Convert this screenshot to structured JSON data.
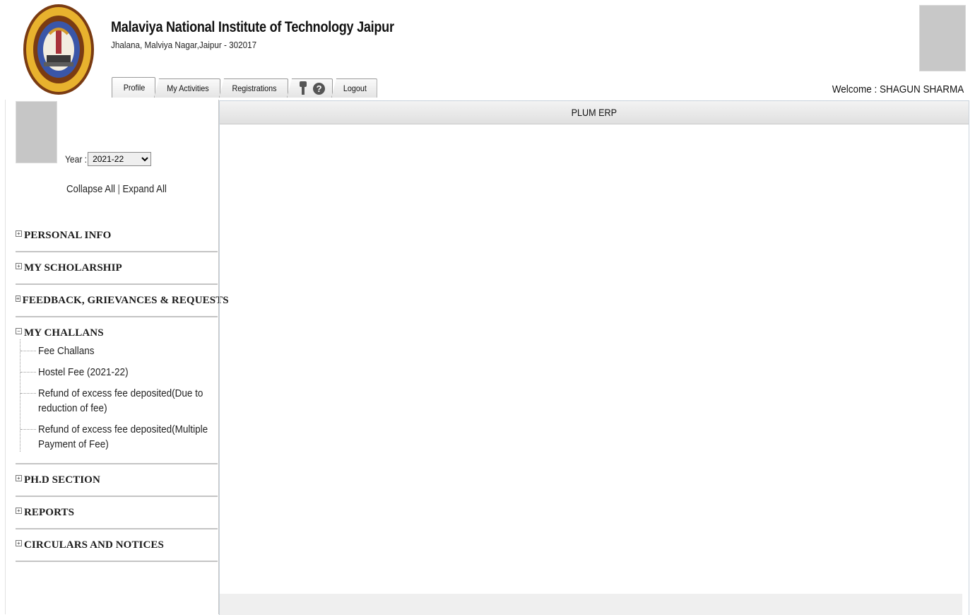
{
  "header": {
    "institute_name": "Malaviya National Institute of Technology Jaipur",
    "institute_address": "Jhalana, Malviya Nagar,Jaipur - 302017",
    "welcome_label": "Welcome : SHAGUN SHARMA"
  },
  "tabs": {
    "profile": "Profile",
    "my_activities": "My Activities",
    "registrations": "Registrations",
    "logout": "Logout",
    "help_glyph": "?"
  },
  "sidebar": {
    "year_label": "Year :",
    "year_selected": "2021-22",
    "collapse_all": "Collapse All",
    "separator": "|",
    "expand_all": "Expand All",
    "sections": [
      {
        "label": "PERSONAL INFO",
        "toggle": "+"
      },
      {
        "label": "MY SCHOLARSHIP",
        "toggle": "+"
      },
      {
        "label": "FEEDBACK, GRIEVANCES & REQUESTS",
        "toggle": "+"
      },
      {
        "label": "MY CHALLANS",
        "toggle": "−",
        "items": [
          "Fee Challans",
          "Hostel Fee (2021-22)",
          "Refund of excess fee deposited(Due to reduction of fee)",
          "Refund of excess fee deposited(Multiple Payment of Fee)"
        ]
      },
      {
        "label": "PH.D SECTION",
        "toggle": "+"
      },
      {
        "label": "REPORTS",
        "toggle": "+"
      },
      {
        "label": "CIRCULARS AND NOTICES",
        "toggle": "+"
      }
    ]
  },
  "main": {
    "title": "PLUM ERP"
  },
  "icons": {
    "logo": "institute-logo",
    "key": "key-icon",
    "help": "help-icon",
    "expand": "plus-box-icon",
    "collapse": "minus-box-icon"
  },
  "colors": {
    "panel_header": "#e6e6e6",
    "divider": "#c4c4c4",
    "photo_placeholder": "#c6c6c6"
  }
}
